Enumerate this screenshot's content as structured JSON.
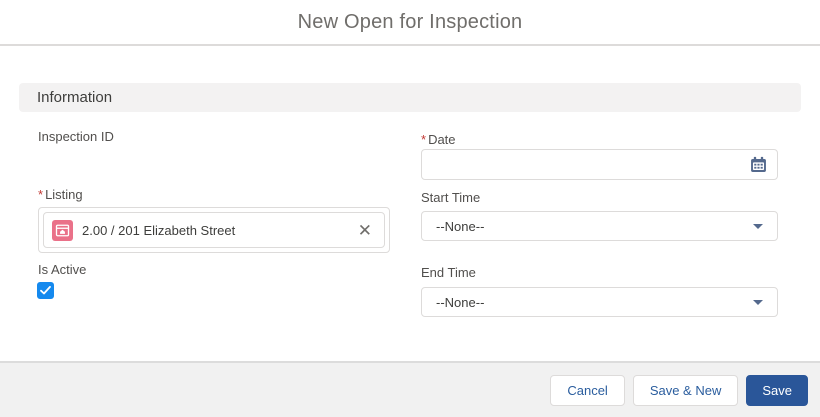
{
  "modal": {
    "title": "New Open for Inspection"
  },
  "section": {
    "title": "Information"
  },
  "fields": {
    "inspection_id": {
      "label": "Inspection ID"
    },
    "listing": {
      "label": "Listing",
      "required_marker": "*",
      "value": "2.00 / 201 Elizabeth Street",
      "icon": "listing-icon",
      "clear_glyph": "✕"
    },
    "is_active": {
      "label": "Is Active",
      "checked": true
    },
    "date": {
      "label": "Date",
      "required_marker": "*",
      "value": "",
      "icon": "calendar-icon"
    },
    "start_time": {
      "label": "Start Time",
      "value": "--None--"
    },
    "end_time": {
      "label": "End Time",
      "value": "--None--"
    }
  },
  "footer": {
    "cancel_label": "Cancel",
    "save_new_label": "Save & New",
    "save_label": "Save"
  },
  "colors": {
    "brand_button_blue": "#2a5699",
    "button_text_blue": "#2a5d9e",
    "checkbox_blue": "#1589ee",
    "listing_icon_pink": "#ea7189",
    "icon_slate": "#54698d",
    "required_red": "#c23934",
    "section_bg": "#f3f2f2",
    "border_gray": "#dddbda"
  }
}
